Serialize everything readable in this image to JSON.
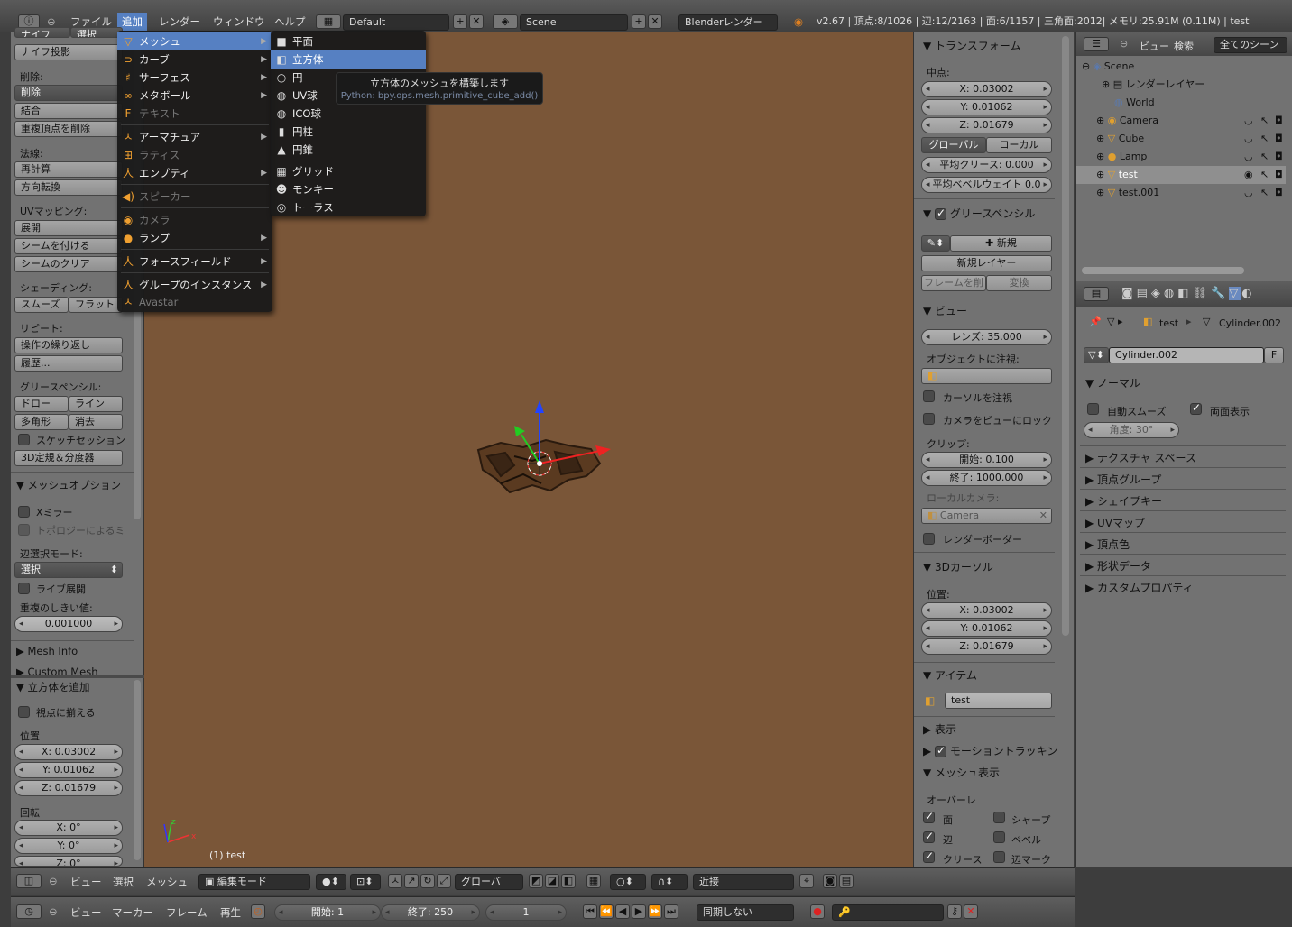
{
  "topbar": {
    "menus": [
      "ファイル",
      "追加",
      "レンダー",
      "ウィンドウ",
      "ヘルプ"
    ],
    "layout": "Default",
    "scene": "Scene",
    "engine": "Blenderレンダー",
    "stats": "v2.67 | 頂点:8/1026 | 辺:12/2163 | 面:6/1157 | 三角面:2012| メモリ:25.91M (0.11M) | test"
  },
  "left_panel": {
    "top_cut": [
      "ナイフ",
      "選択"
    ],
    "knife_project": "ナイフ投影",
    "remove_label": "削除:",
    "delete": "削除",
    "join": "結合",
    "remove_doubles": "重複頂点を削除",
    "normals_label": "法線:",
    "recalc": "再計算",
    "flip": "方向転換",
    "uv_label": "UVマッピング:",
    "unwrap": "展開",
    "mark_seam": "シームを付ける",
    "clear_seam": "シームのクリア",
    "shading_label": "シェーディング:",
    "smooth": "スムーズ",
    "flat": "フラット",
    "repeat_label": "リピート:",
    "repeat_last": "操作の繰り返し",
    "history": "履歴...",
    "grease_label": "グリースペンシル:",
    "draw": "ドロー",
    "line": "ライン",
    "poly": "多角形",
    "erase": "消去",
    "sketch": "スケッチセッション",
    "ruler": "3D定規＆分度器",
    "mesh_options": "メッシュオプション",
    "x_mirror": "Xミラー",
    "topology_mirror": "トポロジーによるミ",
    "edge_select_label": "辺選択モード:",
    "edge_select_value": "選択",
    "live_unwrap": "ライブ展開",
    "double_threshold_label": "重複のしきい値:",
    "double_threshold": "0.001000",
    "mesh_info": "Mesh Info",
    "custom_mesh": "Custom Mesh",
    "add_cube": "立方体を追加",
    "align_view": "視点に揃える",
    "location_label": "位置",
    "loc_x": "X: 0.03002",
    "loc_y": "Y: 0.01062",
    "loc_z": "Z: 0.01679",
    "rotation_label": "回転",
    "rot_x": "X: 0°",
    "rot_y": "Y: 0°",
    "rot_z": "Z: 0°"
  },
  "add_menu": {
    "items": [
      {
        "label": "メッシュ",
        "icon": "▽",
        "arrow": true,
        "highlight": true,
        "disabled": false
      },
      {
        "label": "カーブ",
        "icon": "⊃",
        "arrow": true,
        "highlight": false,
        "disabled": false
      },
      {
        "label": "サーフェス",
        "icon": "♯",
        "arrow": true,
        "highlight": false,
        "disabled": false
      },
      {
        "label": "メタボール",
        "icon": "∞",
        "arrow": true,
        "highlight": false,
        "disabled": false
      },
      {
        "label": "テキスト",
        "icon": "F",
        "arrow": false,
        "highlight": false,
        "disabled": true
      },
      {
        "label": "アーマチュア",
        "icon": "ㅅ",
        "arrow": true,
        "highlight": false,
        "disabled": false
      },
      {
        "label": "ラティス",
        "icon": "⊞",
        "arrow": false,
        "highlight": false,
        "disabled": true
      },
      {
        "label": "エンプティ",
        "icon": "人",
        "arrow": true,
        "highlight": false,
        "disabled": false
      },
      {
        "label": "スピーカー",
        "icon": "◀)",
        "arrow": false,
        "highlight": false,
        "disabled": true
      },
      {
        "label": "カメラ",
        "icon": "◉",
        "arrow": false,
        "highlight": false,
        "disabled": true
      },
      {
        "label": "ランプ",
        "icon": "●",
        "arrow": true,
        "highlight": false,
        "disabled": false
      },
      {
        "label": "フォースフィールド",
        "icon": "人",
        "arrow": true,
        "highlight": false,
        "disabled": false
      },
      {
        "label": "グループのインスタンス",
        "icon": "人",
        "arrow": true,
        "highlight": false,
        "disabled": false
      },
      {
        "label": "Avastar",
        "icon": "ㅅ",
        "arrow": false,
        "highlight": false,
        "disabled": true
      }
    ]
  },
  "mesh_submenu": {
    "items": [
      {
        "label": "平面",
        "icon": "■",
        "highlight": false
      },
      {
        "label": "立方体",
        "icon": "◧",
        "highlight": true
      },
      {
        "label": "円",
        "icon": "○",
        "highlight": false
      },
      {
        "label": "UV球",
        "icon": "◍",
        "highlight": false
      },
      {
        "label": "ICO球",
        "icon": "◍",
        "highlight": false
      },
      {
        "label": "円柱",
        "icon": "▮",
        "highlight": false
      },
      {
        "label": "円錐",
        "icon": "▲",
        "highlight": false
      },
      {
        "label": "グリッド",
        "icon": "▦",
        "highlight": false
      },
      {
        "label": "モンキー",
        "icon": "☻",
        "highlight": false
      },
      {
        "label": "トーラス",
        "icon": "◎",
        "highlight": false
      }
    ]
  },
  "tooltip": {
    "title": "立方体のメッシュを構築します",
    "python": "Python: bpy.ops.mesh.primitive_cube_add()"
  },
  "viewport": {
    "label": "(1) test"
  },
  "n_panel": {
    "transform": "トランスフォーム",
    "median_label": "中点:",
    "mx": "X: 0.03002",
    "my": "Y: 0.01062",
    "mz": "Z: 0.01679",
    "global": "グローバル",
    "local": "ローカル",
    "mean_crease": "平均クリース: 0.000",
    "mean_bevel": "平均ベベルウェイト 0.0",
    "grease": "グリースペンシル",
    "new": "新規",
    "new_layer": "新規レイヤー",
    "frame_delete": "フレームを削",
    "convert": "変換",
    "view": "ビュー",
    "lens": "レンズ: 35.000",
    "lock_object": "オブジェクトに注視:",
    "lock_cursor": "カーソルを注視",
    "lock_camera": "カメラをビューにロック",
    "clip_label": "クリップ:",
    "clip_start": "開始: 0.100",
    "clip_end": "終了: 1000.000",
    "local_camera": "ローカルカメラ:",
    "camera": "Camera",
    "render_border": "レンダーボーダー",
    "cursor": "3Dカーソル",
    "cursor_loc_label": "位置:",
    "cx": "X: 0.03002",
    "cy": "Y: 0.01062",
    "cz": "Z: 0.01679",
    "item": "アイテム",
    "item_name": "test",
    "display": "表示",
    "motion_tracking": "モーショントラッキン",
    "mesh_display": "メッシュ表示",
    "overlay": "オーバーレ",
    "faces": "面",
    "sharp": "シャープ",
    "edges": "辺",
    "bevel": "ベベル",
    "crease": "クリース",
    "edge_mark": "辺マーク"
  },
  "outliner": {
    "view": "ビュー",
    "search": "検索",
    "all_scenes": "全てのシーン",
    "rows": [
      {
        "label": "Scene",
        "indent": 0,
        "selected": false
      },
      {
        "label": "レンダーレイヤー",
        "indent": 1,
        "selected": false
      },
      {
        "label": "World",
        "indent": 1,
        "selected": false
      },
      {
        "label": "Camera",
        "indent": 1,
        "selected": false
      },
      {
        "label": "Cube",
        "indent": 1,
        "selected": false
      },
      {
        "label": "Lamp",
        "indent": 1,
        "selected": false
      },
      {
        "label": "test",
        "indent": 1,
        "selected": true
      },
      {
        "label": "test.001",
        "indent": 1,
        "selected": false
      }
    ]
  },
  "props": {
    "obj": "test",
    "mesh": "Cylinder.002",
    "mesh_field": "Cylinder.002",
    "fake_user": "F",
    "normals": "ノーマル",
    "auto_smooth": "自動スムーズ",
    "double_sided": "両面表示",
    "angle": "角度: 30°",
    "sections": [
      "テクスチャ スペース",
      "頂点グループ",
      "シェイプキー",
      "UVマップ",
      "頂点色",
      "形状データ",
      "カスタムプロパティ"
    ]
  },
  "view_header": {
    "view": "ビュー",
    "select": "選択",
    "mesh": "メッシュ",
    "mode": "編集モード",
    "orientation": "グローバ",
    "snap": "近接"
  },
  "timeline": {
    "view": "ビュー",
    "marker": "マーカー",
    "frame": "フレーム",
    "playback": "再生",
    "start": "開始: 1",
    "end": "終了: 250",
    "current": "1",
    "sync": "同期しない"
  },
  "colors": {
    "viewport_bg": "#7a5638",
    "menu_highlight": "#5680c2",
    "panel_bg": "#727272"
  }
}
